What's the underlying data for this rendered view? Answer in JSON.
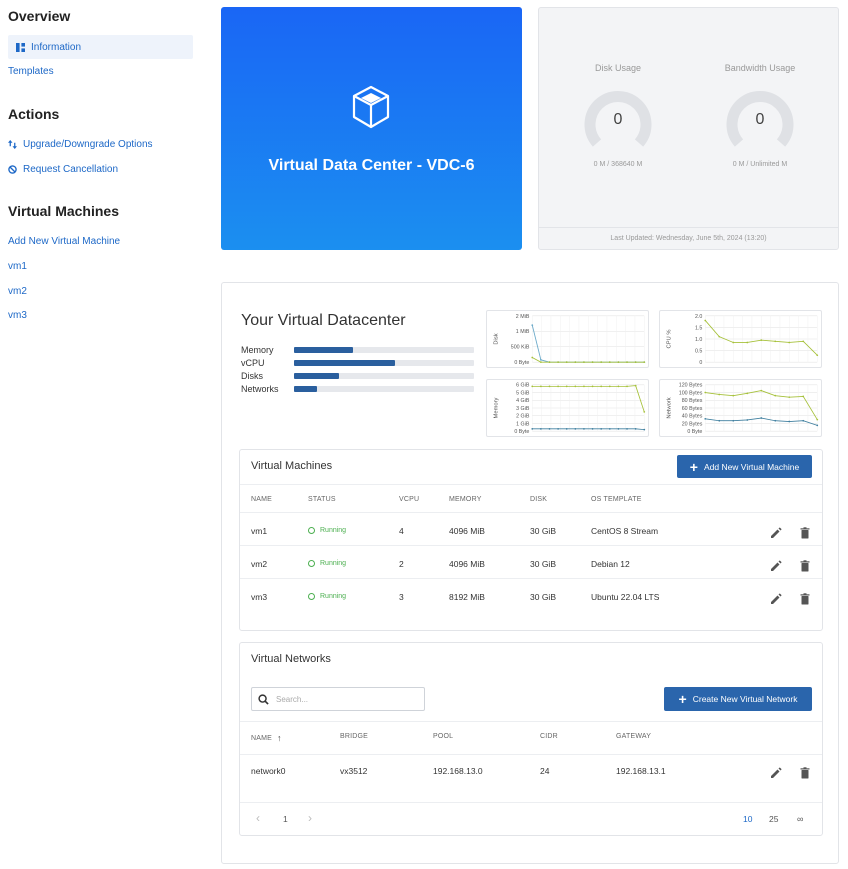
{
  "sidebar": {
    "overview_heading": "Overview",
    "information_label": "Information",
    "templates_label": "Templates",
    "actions_heading": "Actions",
    "upgrade_label": "Upgrade/Downgrade Options",
    "cancel_label": "Request Cancellation",
    "vms_heading": "Virtual Machines",
    "add_vm_label": "Add New Virtual Machine",
    "vm_links": [
      "vm1",
      "vm2",
      "vm3"
    ]
  },
  "hero": {
    "title": "Virtual Data Center - VDC-6",
    "bg_color_top": "#1a66f5",
    "bg_color_bottom": "#1b8ff0"
  },
  "usage": {
    "disk": {
      "label": "Disk Usage",
      "value": "0",
      "sub": "0 M / 368640 M"
    },
    "bandwidth": {
      "label": "Bandwidth Usage",
      "value": "0",
      "sub": "0 M / Unlimited M"
    },
    "last_updated": "Last Updated: Wednesday, June 5th, 2024 (13:20)"
  },
  "datacenter": {
    "title": "Your Virtual Datacenter",
    "resources": [
      {
        "label": "Memory",
        "fraction": 0.33
      },
      {
        "label": "vCPU",
        "fraction": 0.56
      },
      {
        "label": "Disks",
        "fraction": 0.25
      },
      {
        "label": "Networks",
        "fraction": 0.13
      }
    ]
  },
  "chart_data": [
    {
      "type": "line",
      "ylabel": "Disk",
      "yticks": [
        "0 Byte",
        "500 KiB",
        "1 MiB",
        "2 MiB"
      ],
      "ylim": [
        0,
        2
      ],
      "series": [
        {
          "color": "#6aa9c9",
          "values": [
            1.6,
            0.1,
            0,
            0,
            0,
            0,
            0,
            0,
            0,
            0,
            0,
            0,
            0,
            0
          ]
        },
        {
          "color": "#a6c13a",
          "values": [
            0.2,
            0,
            0,
            0,
            0,
            0,
            0,
            0,
            0,
            0,
            0,
            0,
            0,
            0
          ]
        }
      ]
    },
    {
      "type": "line",
      "ylabel": "CPU %",
      "yticks": [
        "0",
        "0.5",
        "1.0",
        "1.5",
        "2.0"
      ],
      "ylim": [
        0,
        2
      ],
      "series": [
        {
          "color": "#a6c13a",
          "values": [
            1.8,
            1.1,
            0.85,
            0.85,
            0.95,
            0.9,
            0.85,
            0.9,
            0.3
          ]
        }
      ]
    },
    {
      "type": "line",
      "ylabel": "Memory",
      "yticks": [
        "0 Byte",
        "1 GiB",
        "2 GiB",
        "3 GiB",
        "4 GiB",
        "5 GiB",
        "6 GiB"
      ],
      "ylim": [
        0,
        6
      ],
      "series": [
        {
          "color": "#a6c13a",
          "values": [
            5.8,
            5.8,
            5.8,
            5.8,
            5.8,
            5.8,
            5.8,
            5.8,
            5.8,
            5.8,
            5.8,
            5.8,
            5.9,
            2.5
          ]
        },
        {
          "color": "#3f7f9f",
          "values": [
            0.3,
            0.3,
            0.3,
            0.3,
            0.3,
            0.3,
            0.3,
            0.3,
            0.3,
            0.3,
            0.3,
            0.3,
            0.3,
            0.2
          ]
        }
      ]
    },
    {
      "type": "line",
      "ylabel": "Network",
      "yticks": [
        "0 Byte",
        "20 Bytes",
        "40 Bytes",
        "60 Bytes",
        "80 Bytes",
        "100 Bytes",
        "120 Bytes"
      ],
      "ylim": [
        0,
        120
      ],
      "series": [
        {
          "color": "#a6c13a",
          "values": [
            100,
            95,
            92,
            98,
            105,
            92,
            88,
            90,
            30
          ]
        },
        {
          "color": "#3f7f9f",
          "values": [
            32,
            27,
            27,
            29,
            34,
            27,
            25,
            27,
            15
          ]
        }
      ]
    }
  ],
  "vm_card": {
    "title": "Virtual Machines",
    "add_button": "Add New Virtual Machine",
    "headers": [
      "Name",
      "Status",
      "vCPU",
      "Memory",
      "Disk",
      "OS Template"
    ],
    "rows": [
      {
        "name": "vm1",
        "status": "Running",
        "vcpu": "4",
        "memory": "4096 MiB",
        "disk": "30 GiB",
        "os": "CentOS 8 Stream"
      },
      {
        "name": "vm2",
        "status": "Running",
        "vcpu": "2",
        "memory": "4096 MiB",
        "disk": "30 GiB",
        "os": "Debian 12"
      },
      {
        "name": "vm3",
        "status": "Running",
        "vcpu": "3",
        "memory": "8192 MiB",
        "disk": "30 GiB",
        "os": "Ubuntu 22.04 LTS"
      }
    ]
  },
  "net_card": {
    "title": "Virtual Networks",
    "search_placeholder": "Search...",
    "create_button": "Create New Virtual Network",
    "headers": [
      "Name",
      "Bridge",
      "Pool",
      "CIDR",
      "Gateway"
    ],
    "sort_arrow": "↑",
    "rows": [
      {
        "name": "network0",
        "bridge": "vx3512",
        "pool": "192.168.13.0",
        "cidr": "24",
        "gateway": "192.168.13.1"
      }
    ],
    "pager": {
      "prev": "‹",
      "page": "1",
      "next": "›",
      "sizes": [
        "10",
        "25",
        "∞"
      ]
    }
  }
}
